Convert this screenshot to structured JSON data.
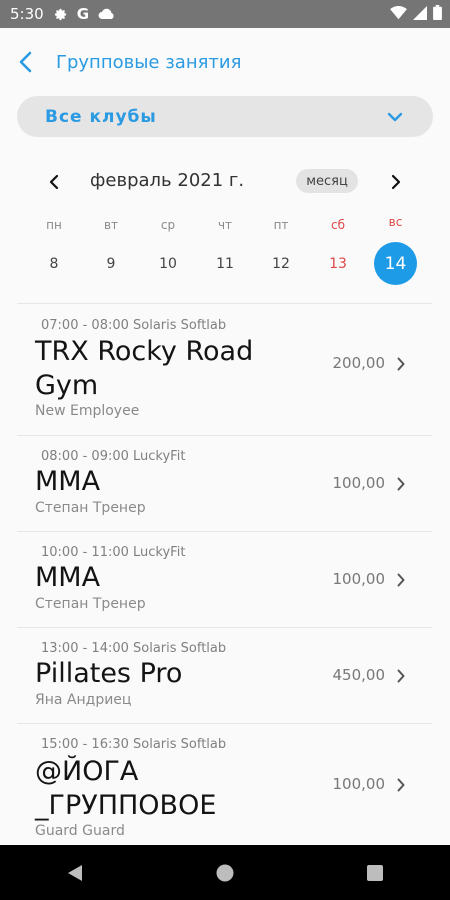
{
  "status": {
    "time": "5:30",
    "google_letter": "G"
  },
  "header": {
    "title": "Групповые занятия"
  },
  "club_filter": {
    "value": "Все клубы"
  },
  "calendar": {
    "month_label": "февраль 2021 г.",
    "view_toggle": "месяц",
    "days": [
      {
        "dow": "пн",
        "num": "8",
        "weekend": false
      },
      {
        "dow": "вт",
        "num": "9",
        "weekend": false
      },
      {
        "dow": "ср",
        "num": "10",
        "weekend": false
      },
      {
        "dow": "чт",
        "num": "11",
        "weekend": false
      },
      {
        "dow": "пт",
        "num": "12",
        "weekend": false
      },
      {
        "dow": "сб",
        "num": "13",
        "weekend": true
      },
      {
        "dow": "вс",
        "num": "14",
        "weekend": true,
        "selected": true
      }
    ]
  },
  "sessions": [
    {
      "time": "07:00 - 08:00 Solaris Softlab",
      "title": "TRX Rocky Road Gym",
      "trainer": "New Employee",
      "price": "200,00"
    },
    {
      "time": "08:00 - 09:00 LuckyFit",
      "title": "MMA",
      "trainer": "Степан Тренер",
      "price": "100,00"
    },
    {
      "time": "10:00 - 11:00 LuckyFit",
      "title": "MMA",
      "trainer": "Степан Тренер",
      "price": "100,00"
    },
    {
      "time": "13:00 - 14:00 Solaris Softlab",
      "title": "Pillates Pro",
      "trainer": "Яна Андриец",
      "price": "450,00"
    },
    {
      "time": "15:00 - 16:30 Solaris Softlab",
      "title": "@ЙОГА _ГРУППОВОЕ",
      "trainer": "Guard Guard",
      "price": "100,00"
    }
  ],
  "colors": {
    "accent": "#2a9ae2",
    "selected_day": "#1d9be6",
    "weekend": "#e04848",
    "statusbar": "#757575"
  }
}
